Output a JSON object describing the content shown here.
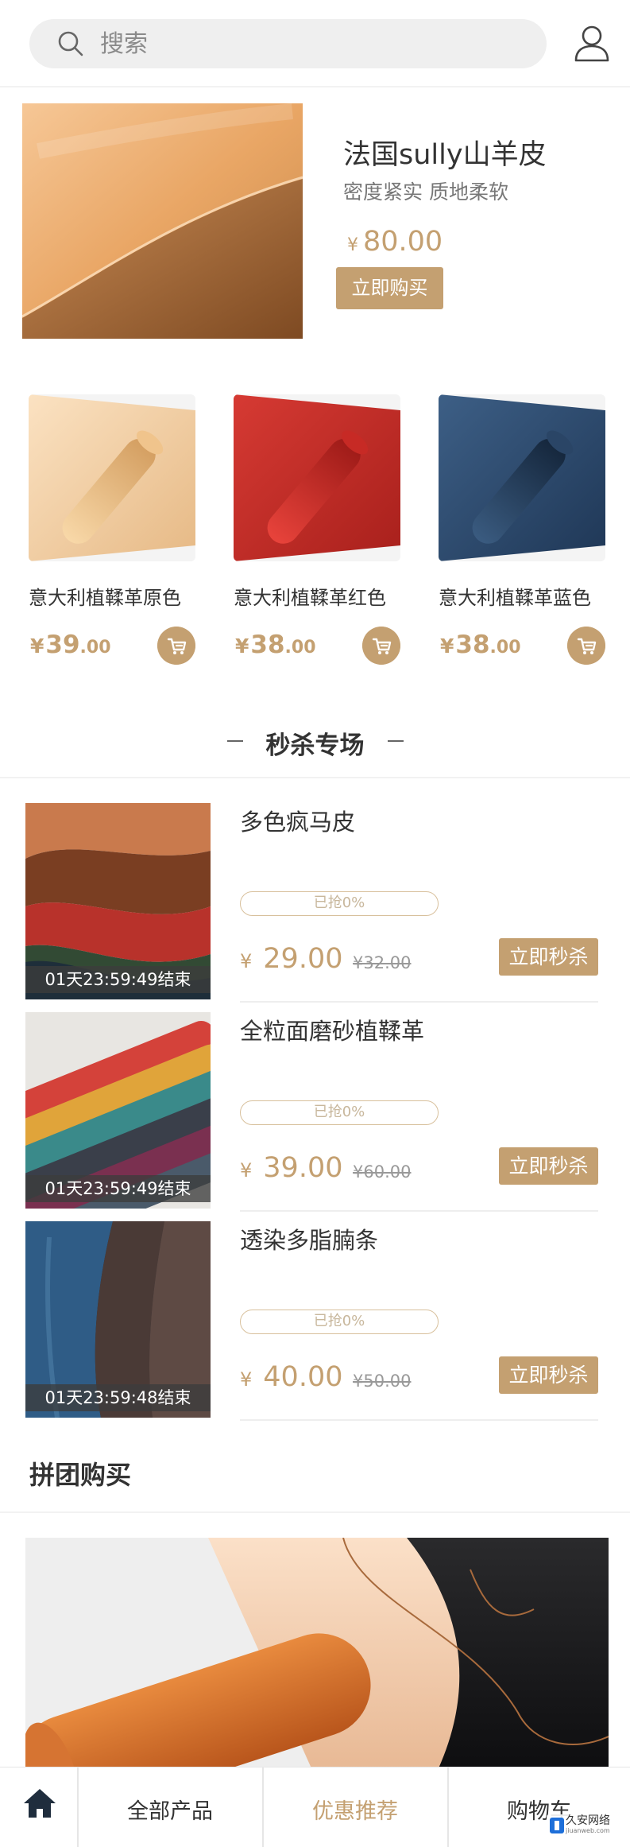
{
  "header": {
    "search_placeholder": "搜索"
  },
  "featured": {
    "title": "法国sully山羊皮",
    "subtitle": "密度紧实 质地柔软",
    "currency": "¥",
    "price": "80.00",
    "buy_label": "立即购买"
  },
  "grid_products": [
    {
      "name": "意大利植鞣革原色",
      "currency": "¥",
      "price_int": "39",
      "price_dec": ".00",
      "color": "#e8c28e"
    },
    {
      "name": "意大利植鞣革红色",
      "currency": "¥",
      "price_int": "38",
      "price_dec": ".00",
      "color": "#c42a25"
    },
    {
      "name": "意大利植鞣革蓝色",
      "currency": "¥",
      "price_int": "38",
      "price_dec": ".00",
      "color": "#2c4a6e"
    }
  ],
  "flash_sale": {
    "title": "秒杀专场",
    "items": [
      {
        "name": "多色疯马皮",
        "progress": "已抢0%",
        "currency": "¥",
        "price": "29.00",
        "original": "¥32.00",
        "timer": "01天23:59:49结束",
        "button": "立即秒杀"
      },
      {
        "name": "全粒面磨砂植鞣革",
        "progress": "已抢0%",
        "currency": "¥",
        "price": "39.00",
        "original": "¥60.00",
        "timer": "01天23:59:49结束",
        "button": "立即秒杀"
      },
      {
        "name": "透染多脂腩条",
        "progress": "已抢0%",
        "currency": "¥",
        "price": "40.00",
        "original": "¥50.00",
        "timer": "01天23:59:48结束",
        "button": "立即秒杀"
      }
    ]
  },
  "group_buy": {
    "title": "拼团购买"
  },
  "bottom_nav": {
    "items": [
      {
        "label": "全部产品",
        "active": false
      },
      {
        "label": "优惠推荐",
        "active": true
      },
      {
        "label": "购物车",
        "active": false
      }
    ]
  },
  "watermark": {
    "text": "久安网络",
    "sub": "jiuanweb.com"
  },
  "colors": {
    "accent": "#c4a071",
    "text": "#333333",
    "muted": "#999999"
  }
}
